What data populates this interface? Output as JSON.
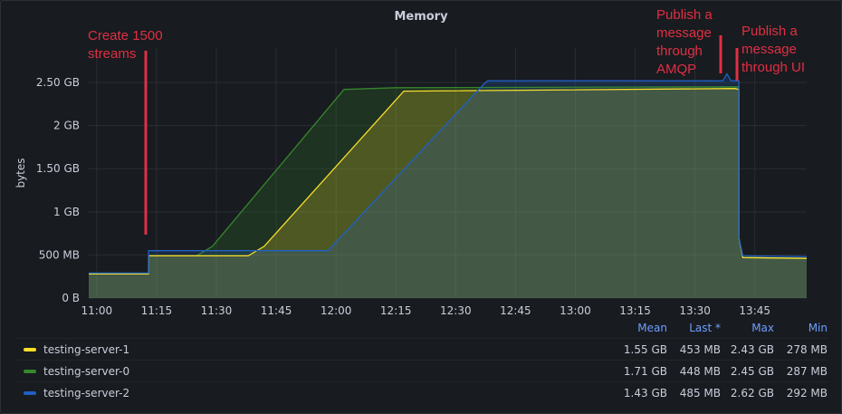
{
  "panel": {
    "title": "Memory"
  },
  "colors": {
    "testing-server-1": "#fade2a",
    "testing-server-0": "#37872d",
    "testing-server-2": "#1f60c4",
    "annotation": "#e02f44"
  },
  "chart_data": {
    "type": "area",
    "title": "Memory",
    "xlabel": "",
    "ylabel": "bytes",
    "x_ticks": [
      "11:00",
      "11:15",
      "11:30",
      "11:45",
      "12:00",
      "12:15",
      "12:30",
      "12:45",
      "13:00",
      "13:15",
      "13:30",
      "13:45"
    ],
    "y_ticks": [
      "0 B",
      "500 MB",
      "1 GB",
      "1.50 GB",
      "2 GB",
      "2.50 GB"
    ],
    "ylim_gb": [
      0,
      2.9
    ],
    "grid": true,
    "legend_placement": "bottom",
    "series": [
      {
        "name": "testing-server-2",
        "points": [
          [
            "10:58",
            0.29
          ],
          [
            "11:13",
            0.29
          ],
          [
            "11:13",
            0.55
          ],
          [
            "11:35",
            0.55
          ],
          [
            "11:58",
            0.55
          ],
          [
            "12:37",
            2.48
          ],
          [
            "12:38",
            2.52
          ],
          [
            "13:25",
            2.52
          ],
          [
            "13:37",
            2.52
          ],
          [
            "13:38",
            2.6
          ],
          [
            "13:39",
            2.52
          ],
          [
            "13:41",
            2.52
          ],
          [
            "13:41",
            0.7
          ],
          [
            "13:42",
            0.49
          ],
          [
            "13:58",
            0.48
          ]
        ]
      },
      {
        "name": "testing-server-1",
        "points": [
          [
            "10:58",
            0.28
          ],
          [
            "11:13",
            0.28
          ],
          [
            "11:13",
            0.49
          ],
          [
            "11:38",
            0.49
          ],
          [
            "11:42",
            0.6
          ],
          [
            "12:17",
            2.4
          ],
          [
            "13:40",
            2.43
          ],
          [
            "13:41",
            2.42
          ],
          [
            "13:41",
            0.7
          ],
          [
            "13:42",
            0.47
          ],
          [
            "13:58",
            0.46
          ]
        ]
      },
      {
        "name": "testing-server-0",
        "points": [
          [
            "10:58",
            0.29
          ],
          [
            "11:13",
            0.29
          ],
          [
            "11:13",
            0.49
          ],
          [
            "11:25",
            0.49
          ],
          [
            "11:29",
            0.6
          ],
          [
            "12:02",
            2.42
          ],
          [
            "12:15",
            2.44
          ],
          [
            "13:41",
            2.45
          ],
          [
            "13:41",
            0.7
          ],
          [
            "13:42",
            0.47
          ],
          [
            "13:58",
            0.46
          ]
        ]
      }
    ],
    "annotations": [
      {
        "id": "create",
        "time": "11:13",
        "lines": [
          "Create 1500",
          "streams"
        ]
      },
      {
        "id": "amqp",
        "time": "13:37",
        "lines": [
          "Publish a",
          "message",
          "through",
          "AMQP"
        ]
      },
      {
        "id": "ui",
        "time": "13:41",
        "lines": [
          "Publish a",
          "message",
          "through UI"
        ]
      }
    ],
    "legend": {
      "columns": [
        "Mean",
        "Last *",
        "Max",
        "Min"
      ],
      "rows": [
        {
          "name": "testing-server-1",
          "values": [
            "1.55 GB",
            "453 MB",
            "2.43 GB",
            "278 MB"
          ]
        },
        {
          "name": "testing-server-0",
          "values": [
            "1.71 GB",
            "448 MB",
            "2.45 GB",
            "287 MB"
          ]
        },
        {
          "name": "testing-server-2",
          "values": [
            "1.43 GB",
            "485 MB",
            "2.62 GB",
            "292 MB"
          ]
        }
      ]
    }
  }
}
